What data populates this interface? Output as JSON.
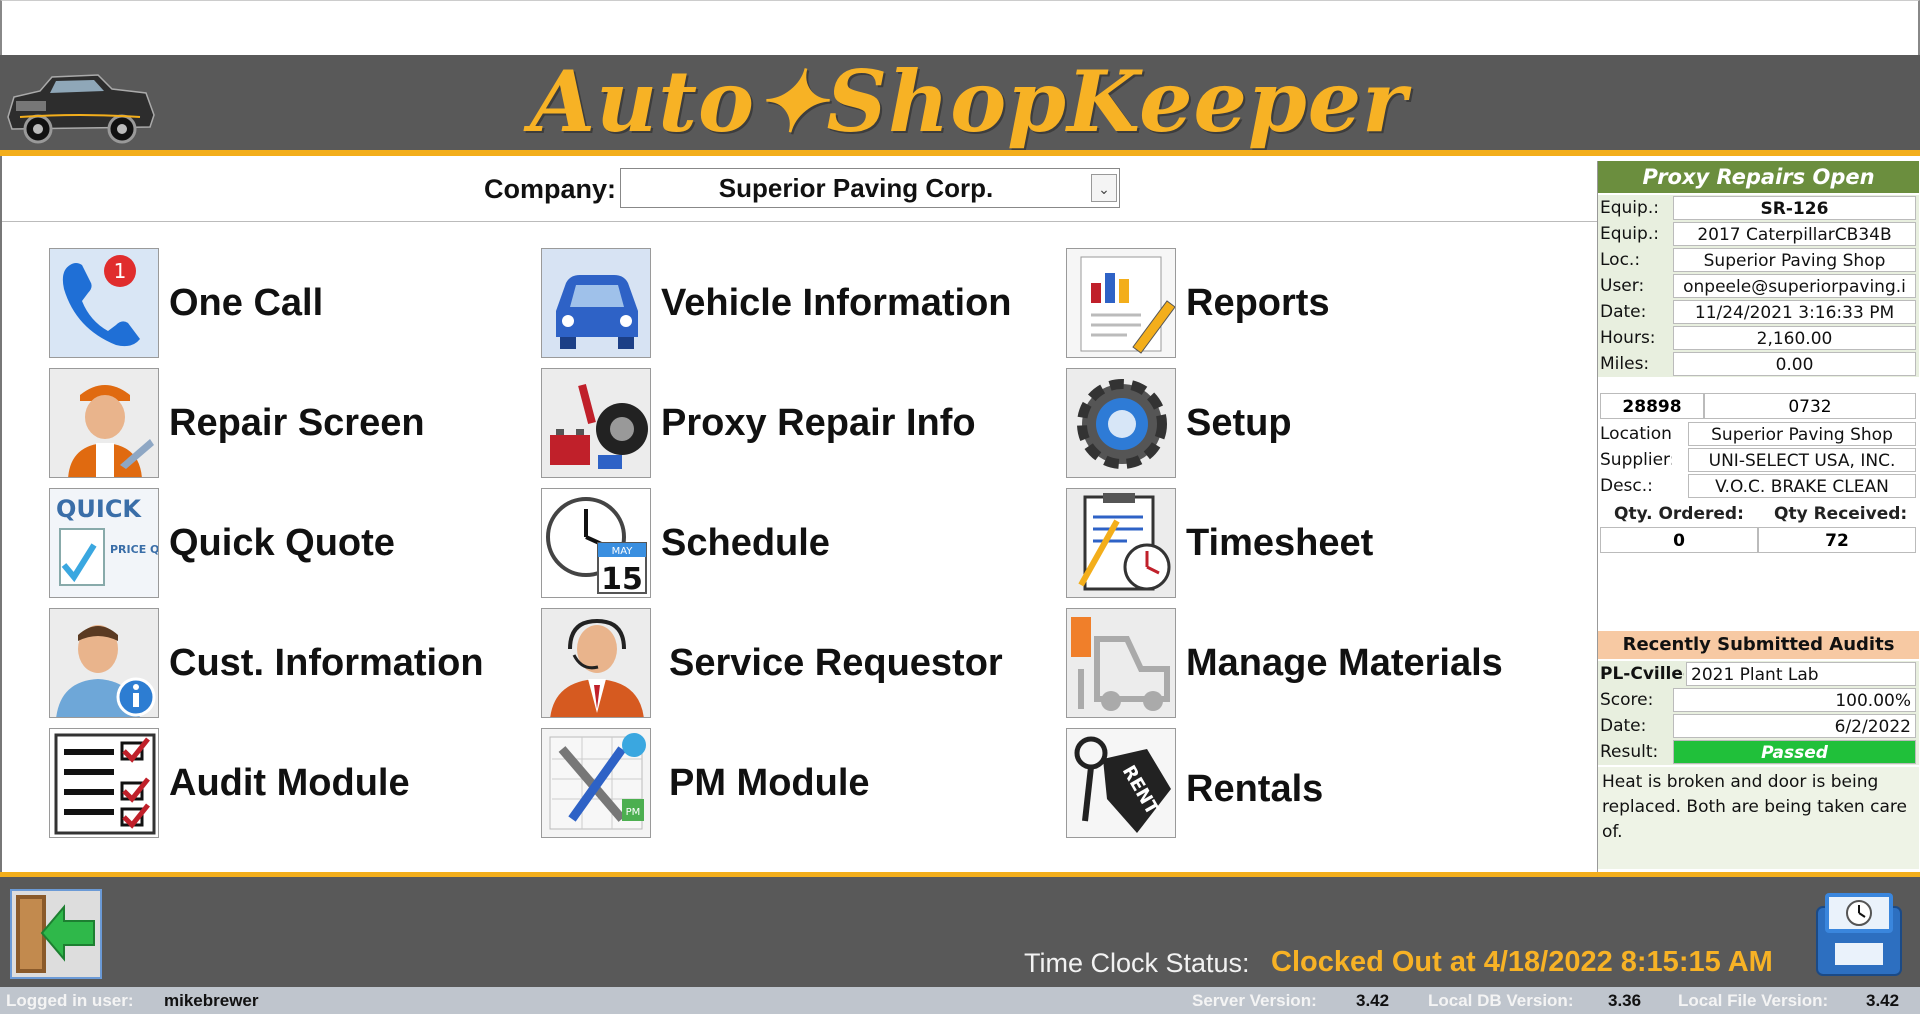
{
  "brand": {
    "title": "Auto✦ShopKeeper"
  },
  "company": {
    "label": "Company:",
    "value": "Superior Paving Corp."
  },
  "menu": {
    "one_call": "One Call",
    "repair_screen": "Repair Screen",
    "quick_quote": "Quick Quote",
    "cust_information": "Cust. Information",
    "audit_module": "Audit Module",
    "vehicle_information": "Vehicle Information",
    "proxy_repair_info": "Proxy Repair Info",
    "schedule": "Schedule",
    "service_requestor": "Service Requestor",
    "pm_module": "PM Module",
    "reports": "Reports",
    "setup": "Setup",
    "timesheet": "Timesheet",
    "manage_materials": "Manage Materials",
    "rentals": "Rentals"
  },
  "icons": {
    "one_call_badge": "1",
    "quick_quote_text": "QUICK",
    "price_quote_text": "PRICE QUOTE",
    "schedule_day": "15",
    "schedule_month": "MAY",
    "rent_tag": "RENT",
    "pm_tag": "PM"
  },
  "proxy": {
    "title": "Proxy Repairs Open",
    "fields": [
      {
        "k": "Equip.:",
        "v": "SR-126"
      },
      {
        "k": "Equip.:",
        "v": "2017 CaterpillarCB34B"
      },
      {
        "k": "Loc.:",
        "v": "Superior Paving Shop"
      },
      {
        "k": "User:",
        "v": "onpeele@superiorpaving.i"
      },
      {
        "k": "Date:",
        "v": "11/24/2021 3:16:33 PM"
      },
      {
        "k": "Hours:",
        "v": "2,160.00"
      },
      {
        "k": "Miles:",
        "v": "0.00"
      }
    ],
    "num_a": "28898",
    "num_b": "0732",
    "location_label": "Location:",
    "location": "Superior Paving Shop",
    "supplier_label": "Supplier:",
    "supplier": "UNI-SELECT USA, INC.",
    "desc_label": "Desc.:",
    "desc": "V.O.C. BRAKE CLEAN",
    "qty_ordered_label": "Qty. Ordered:",
    "qty_received_label": "Qty Received:",
    "qty_ordered": "0",
    "qty_received": "72"
  },
  "audits": {
    "title": "Recently Submitted Audits",
    "code": "PL-Cville-Lal",
    "name": "2021 Plant Lab",
    "score_label": "Score:",
    "score": "100.00%",
    "date_label": "Date:",
    "date": "6/2/2022",
    "result_label": "Result:",
    "result": "Passed",
    "note": "Heat is broken and door is being replaced. Both are being taken care of."
  },
  "timeclock": {
    "label": "Time Clock Status:",
    "value": "Clocked Out at 4/18/2022 8:15:15 AM"
  },
  "status": {
    "logged_label": "Logged in user:",
    "user": "mikebrewer",
    "server_label": "Server Version:",
    "server": "3.42",
    "localdb_label": "Local DB Version:",
    "localdb": "3.36",
    "localfile_label": "Local File Version:",
    "localfile": "3.42"
  },
  "colors": {
    "accent": "#f3ae1b",
    "band": "#595959",
    "brand_text": "#f7b225",
    "passed": "#20c03a"
  }
}
